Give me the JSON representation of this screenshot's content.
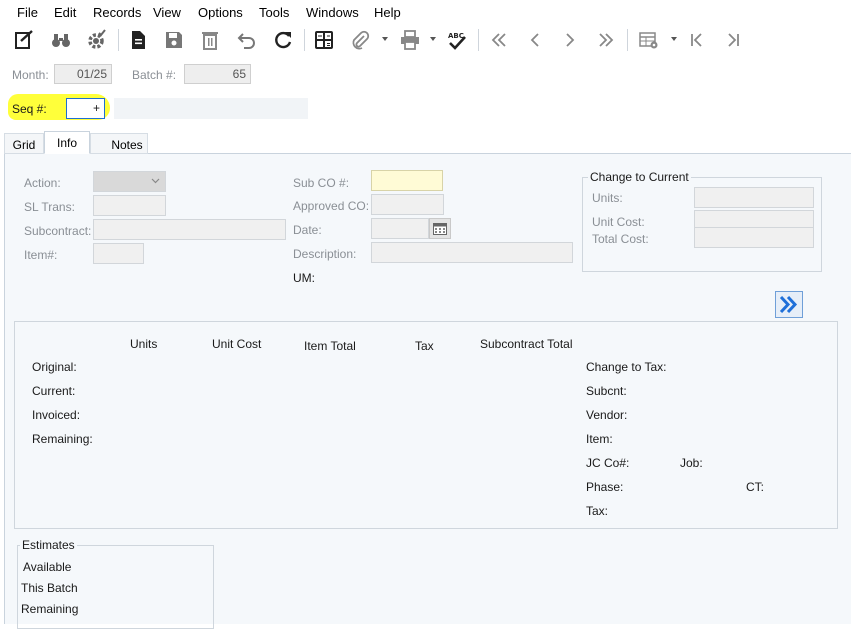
{
  "menu": {
    "items": [
      "File",
      "Edit",
      "Records",
      "View",
      "Options",
      "Tools",
      "Windows",
      "Help"
    ]
  },
  "toolbar": {
    "icons": [
      "edit-notes-icon",
      "binoculars-icon",
      "gear-check-icon",
      "document-icon",
      "save-icon",
      "delete-icon",
      "undo-icon",
      "refresh-icon",
      "calculator-icon",
      "attachment-icon",
      "print-icon",
      "spellcheck-icon",
      "first-record-icon",
      "previous-record-icon",
      "next-record-icon",
      "last-record-icon",
      "grid-settings-icon",
      "first-page-icon",
      "last-page-icon"
    ]
  },
  "header": {
    "month_label": "Month:",
    "month_value": "01/25",
    "batch_label": "Batch #:",
    "batch_value": "65",
    "seq_label": "Seq #:",
    "seq_value": "+",
    "highlight_color": "#ffff3a"
  },
  "tabs": [
    {
      "label": "Grid"
    },
    {
      "label": "Info"
    },
    {
      "label": "Notes"
    }
  ],
  "info": {
    "action_label": "Action:",
    "sl_trans_label": "SL Trans:",
    "subcontract_label": "Subcontract:",
    "item_label": "Item#:",
    "sub_co_label": "Sub CO #:",
    "approved_co_label": "Approved CO:",
    "date_label": "Date:",
    "description_label": "Description:",
    "um_label": "UM:",
    "change_to_current": {
      "title": "Change to Current",
      "units_label": "Units:",
      "unit_cost_label": "Unit Cost:",
      "total_cost_label": "Total Cost:"
    }
  },
  "totals": {
    "columns": [
      "Units",
      "Unit Cost",
      "Item Total",
      "Tax",
      "Subcontract Total"
    ],
    "rows": [
      "Original:",
      "Current:",
      "Invoiced:",
      "Remaining:"
    ],
    "right_labels": {
      "change_to_tax": "Change to Tax:",
      "subcnt": "Subcnt:",
      "vendor": "Vendor:",
      "item": "Item:",
      "jc_co": "JC Co#:",
      "job": "Job:",
      "phase": "Phase:",
      "ct": "CT:",
      "tax": "Tax:"
    }
  },
  "estimates": {
    "title": "Estimates",
    "rows": [
      "Available",
      "This Batch",
      "Remaining"
    ]
  },
  "colors": {
    "panel_bg": "#f5f8fb",
    "sub_co_field": "#fffbd6",
    "forward_button": "#1e6fd9"
  }
}
